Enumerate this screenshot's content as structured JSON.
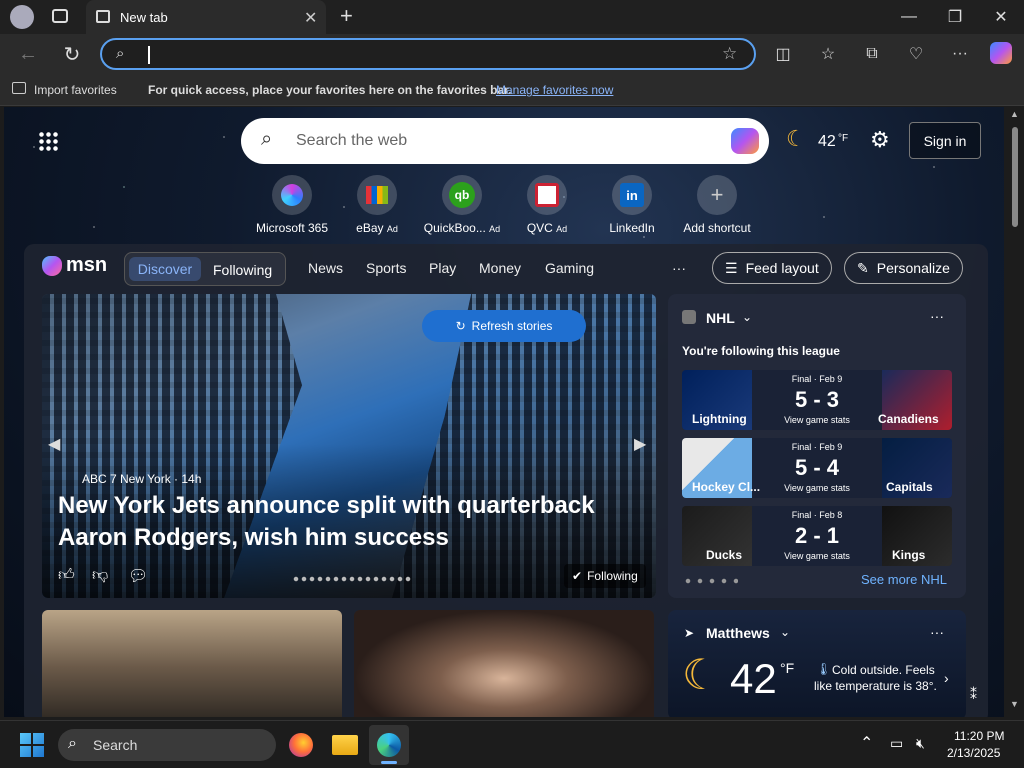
{
  "browser": {
    "tab_title": "New tab",
    "address_value": "",
    "favorites_import": "Import favorites",
    "favorites_message": "For quick access, place your favorites here on the favorites bar.",
    "favorites_link": "Manage favorites now"
  },
  "header": {
    "search_placeholder": "Search the web",
    "temp": "42",
    "temp_unit": "°F",
    "sign_in": "Sign in"
  },
  "shortcuts": [
    {
      "label": "Microsoft 365",
      "ad": ""
    },
    {
      "label": "eBay",
      "ad": "Ad"
    },
    {
      "label": "QuickBoo...",
      "ad": "Ad"
    },
    {
      "label": "QVC",
      "ad": "Ad"
    },
    {
      "label": "LinkedIn",
      "ad": ""
    },
    {
      "label": "Add shortcut",
      "ad": ""
    }
  ],
  "feed_nav": {
    "logo": "msn",
    "discover": "Discover",
    "following": "Following",
    "items": [
      "News",
      "Sports",
      "Play",
      "Money",
      "Gaming"
    ],
    "more": "···",
    "feed_layout": "Feed layout",
    "personalize": "Personalize"
  },
  "hero": {
    "refresh": "Refresh stories",
    "source": "ABC 7 New York · 14h",
    "headline": "New York Jets announce split with quarterback Aaron Rodgers, wish him success",
    "following": "Following"
  },
  "nhl": {
    "title": "NHL",
    "subtitle": "You're following this league",
    "games": [
      {
        "status": "Final · Feb 9",
        "score": "5 - 3",
        "home": "Lightning",
        "away": "Canadiens",
        "stats": "View game stats"
      },
      {
        "status": "Final · Feb 9",
        "score": "5 - 4",
        "home": "Hockey Cl...",
        "away": "Capitals",
        "stats": "View game stats"
      },
      {
        "status": "Final · Feb 8",
        "score": "2 - 1",
        "home": "Ducks",
        "away": "Kings",
        "stats": "View game stats"
      }
    ],
    "see_more": "See more NHL"
  },
  "weather": {
    "location": "Matthews",
    "temp": "42",
    "unit": "°F",
    "desc": "Cold outside. Feels like temperature is 38°."
  },
  "taskbar": {
    "search": "Search",
    "time": "11:20 PM",
    "date": "2/13/2025"
  },
  "colors": {
    "accent": "#5aa0f0",
    "page_bg": "#0f1a2d",
    "card_bg": "#23293a"
  }
}
